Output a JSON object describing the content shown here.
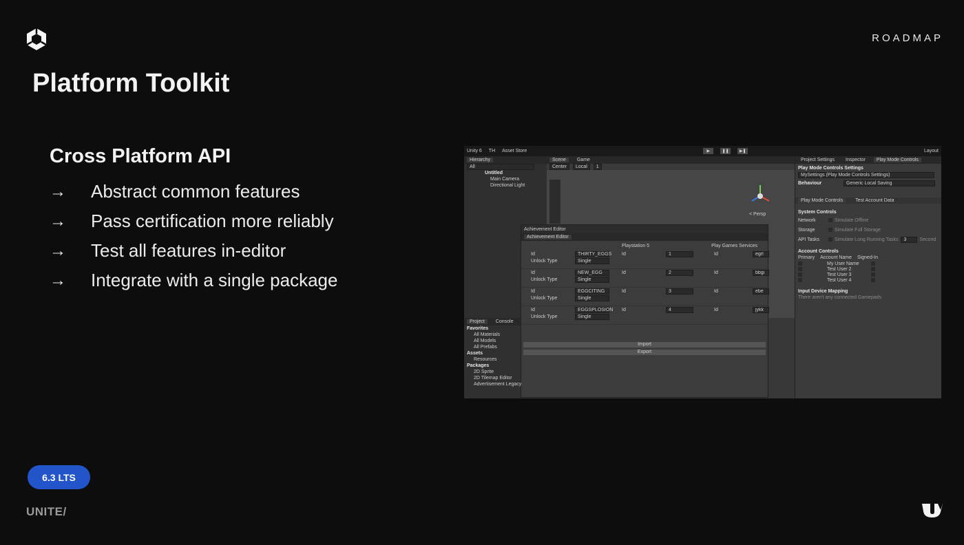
{
  "slide": {
    "roadmap_label": "ROADMAP",
    "title": "Platform Toolkit",
    "section_heading": "Cross Platform API",
    "arrow_glyph": "→",
    "bullets": [
      "Abstract common features",
      "Pass certification more reliably",
      "Test all features in-editor",
      "Integrate with a single package"
    ],
    "version_badge": "6.3 LTS",
    "footer_brand": "UNITE/",
    "colors": {
      "background": "#0d0d0d",
      "badge": "#2155c9",
      "footer_brand": "#9a9a9a"
    }
  },
  "editor": {
    "toolbar": {
      "unity": "Unity 6",
      "account": "TH",
      "asset_store": "Asset Store",
      "layout": "Layout"
    },
    "hierarchy": {
      "tab": "Hierarchy",
      "search": "All",
      "scene": "Untitled",
      "items": [
        "Main Camera",
        "Directional Light"
      ]
    },
    "scene_tabs": [
      "Scene",
      "Game"
    ],
    "scene_toolbar": {
      "pivot": "Center",
      "space": "Local",
      "grid": "1"
    },
    "persp_label": "< Persp",
    "achievement_editor": {
      "window_title": "Achievement Editor",
      "tab": "Achievement Editor",
      "columns": [
        "Playstation 5",
        "Play Games Services"
      ],
      "rows": [
        {
          "id": "THIRTY_EGGS",
          "type": "Single",
          "ps_id": "1",
          "pgs_id": "egrl"
        },
        {
          "id": "NEW_EGG",
          "type": "Single",
          "ps_id": "2",
          "pgs_id": "bbgi"
        },
        {
          "id": "EGGCITING",
          "type": "Single",
          "ps_id": "3",
          "pgs_id": "ebe"
        },
        {
          "id": "EGGSPLOSION",
          "type": "Single",
          "ps_id": "4",
          "pgs_id": "jykk"
        }
      ],
      "id_label": "Id",
      "unlock_label": "Unlock Type",
      "import_button": "Import",
      "export_button": "Export"
    },
    "project": {
      "tabs": [
        "Project",
        "Console"
      ],
      "favorites_label": "Favorites",
      "favorites": [
        "All Materials",
        "All Models",
        "All Prefabs"
      ],
      "assets_label": "Assets",
      "assets": [
        "Resources"
      ],
      "packages_label": "Packages",
      "packages": [
        "2D Sprite",
        "2D Tilemap Editor",
        "Advertisement Legacy"
      ]
    },
    "inspector": {
      "tabs": [
        "Project Settings",
        "Inspector",
        "Play Mode Controls"
      ],
      "heading": "Play Mode Controls Settings",
      "settings_asset": "MySettings (Play Mode Controls Settings)",
      "behaviour_label": "Behaviour",
      "behaviour_value": "Generic Local Saving",
      "sub_tabs": [
        "Play Mode Controls",
        "Test Account Data"
      ],
      "system_controls_label": "System Controls",
      "system_controls": [
        {
          "label": "Network",
          "value": "Simulate Offline"
        },
        {
          "label": "Storage",
          "value": "Simulate Full Storage"
        },
        {
          "label": "API Tasks",
          "value": "Simulate Long Running Tasks",
          "extra": "3",
          "unit": "Second"
        }
      ],
      "account_controls_label": "Account Controls",
      "account_headers": [
        "Primary",
        "Account Name",
        "Signed-In"
      ],
      "accounts": [
        "My User Name",
        "Test User 2",
        "Test User 3",
        "Test User 4"
      ],
      "input_mapping_label": "Input Device Mapping",
      "input_mapping_note": "There aren't any connected Gamepads"
    }
  }
}
